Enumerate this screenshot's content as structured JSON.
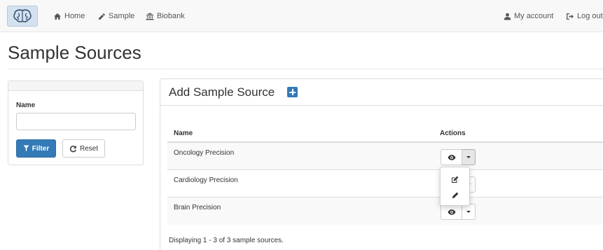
{
  "navbar": {
    "logo_icon": "brain-icon",
    "home": {
      "label": "Home",
      "icon": "home-icon"
    },
    "sample": {
      "label": "Sample",
      "icon": "eyedropper-icon"
    },
    "biobank": {
      "label": "Biobank",
      "icon": "bank-icon"
    },
    "account": {
      "label": "My account",
      "icon": "user-icon"
    },
    "logout": {
      "label": "Log out",
      "icon": "logout-icon"
    }
  },
  "page": {
    "title": "Sample Sources"
  },
  "filter": {
    "name_label": "Name",
    "name_value": "",
    "filter_label": "Filter",
    "filter_icon": "filter-icon",
    "reset_label": "Reset",
    "reset_icon": "refresh-icon"
  },
  "main": {
    "title": "Add Sample Source",
    "add_icon": "plus-square-icon",
    "columns": [
      "Name",
      "Actions"
    ],
    "rows": [
      {
        "name": "Oncology Precision"
      },
      {
        "name": "Cardiology Precision"
      },
      {
        "name": "Brain Precision"
      }
    ],
    "dropdown_items": [
      {
        "icon": "edit-icon"
      },
      {
        "icon": "pencil-icon"
      }
    ],
    "footer": "Displaying 1 - 3 of 3 sample sources."
  },
  "colors": {
    "primary": "#337ab7",
    "navbar_bg": "#f8f8f8",
    "stripe": "#f9f9f9"
  }
}
